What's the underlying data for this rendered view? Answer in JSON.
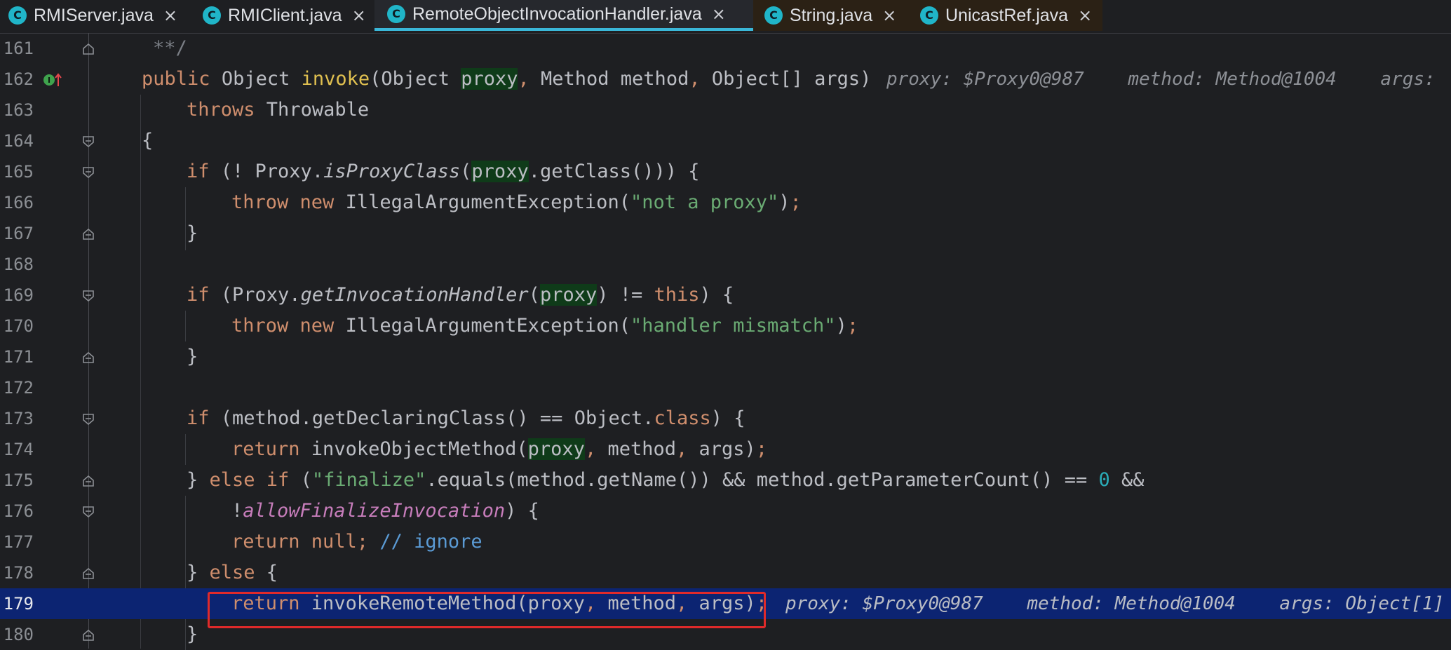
{
  "tabs": [
    {
      "label": "RMIServer.java",
      "active": false
    },
    {
      "label": "RMIClient.java",
      "active": false
    },
    {
      "label": "RemoteObjectInvocationHandler.java",
      "active": true
    },
    {
      "label": "String.java",
      "active": false
    },
    {
      "label": "UnicastRef.java",
      "active": false
    }
  ],
  "tab_icon_letter": "C",
  "close_glyph": "×",
  "lines": [
    {
      "num": "161"
    },
    {
      "num": "162"
    },
    {
      "num": "163"
    },
    {
      "num": "164"
    },
    {
      "num": "165"
    },
    {
      "num": "166"
    },
    {
      "num": "167"
    },
    {
      "num": "168"
    },
    {
      "num": "169"
    },
    {
      "num": "170"
    },
    {
      "num": "171"
    },
    {
      "num": "172"
    },
    {
      "num": "173"
    },
    {
      "num": "174"
    },
    {
      "num": "175"
    },
    {
      "num": "176"
    },
    {
      "num": "177"
    },
    {
      "num": "178"
    },
    {
      "num": "179"
    },
    {
      "num": "180"
    }
  ],
  "code": {
    "l161": "**/",
    "l162": {
      "public": "public",
      "type": "Object ",
      "name": "invoke",
      "open": "(Object ",
      "p1": "proxy",
      "c1": ",",
      "p2": " Method method",
      "c2": ",",
      "p3": " Object[] args)"
    },
    "l163": {
      "throws": "throws",
      "rest": " Throwable"
    },
    "l164": "{",
    "l165": {
      "if": "if",
      "a": " (! Proxy.",
      "m": "isProxyClass",
      "b": "(",
      "p": "proxy",
      "c": ".getClass())) {"
    },
    "l166": {
      "throw": "throw new",
      "a": " IllegalArgumentException(",
      "s": "\"not a proxy\"",
      "b": ")",
      "semi": ";"
    },
    "l167": "}",
    "l169": {
      "if": "if",
      "a": " (Proxy.",
      "m": "getInvocationHandler",
      "b": "(",
      "p": "proxy",
      "c": ") != ",
      "this": "this",
      "d": ") {"
    },
    "l170": {
      "throw": "throw new",
      "a": " IllegalArgumentException(",
      "s": "\"handler mismatch\"",
      "b": ")",
      "semi": ";"
    },
    "l171": "}",
    "l173": {
      "if": "if",
      "a": " (method.getDeclaringClass() == Object.",
      "cls": "class",
      "b": ") {"
    },
    "l174": {
      "ret": "return",
      "a": " invokeObjectMethod(",
      "p": "proxy",
      "c1": ",",
      "b": " method",
      "c2": ",",
      "d": " args)",
      "semi": ";"
    },
    "l175": {
      "a": "} ",
      "els": "else if",
      "b": " (",
      "s": "\"finalize\"",
      "c": ".equals(method.getName()) && method.getParameterCount() == ",
      "n": "0",
      "d": " &&"
    },
    "l176": {
      "a": "!",
      "f": "allowFinalizeInvocation",
      "b": ") {"
    },
    "l177": {
      "ret": "return null",
      "semi": ";",
      "cmt": " // ignore"
    },
    "l178": {
      "a": "} ",
      "els": "else",
      "b": " {"
    },
    "l179": {
      "ret": "return",
      "a": " invokeRemoteMethod(proxy",
      "c1": ",",
      "b": " method",
      "c2": ",",
      "d": " args)",
      "semi": ";"
    },
    "l180": "}"
  },
  "debug_hints": {
    "l162": "proxy: $Proxy0@987    method: Method@1004    args:",
    "l179": "proxy: $Proxy0@987    method: Method@1004    args: Object[1]"
  },
  "colors": {
    "keyword": "#cf8e6d",
    "method": "#56a8f5",
    "string": "#6aab73",
    "number": "#2aacb8",
    "field": "#c77dbb",
    "current_line": "#0c2472",
    "active_tab_underline": "#3ab7d8",
    "highlight_box": "#e02a2a"
  },
  "icons": {
    "tab": "java-class-icon",
    "gutter_162": "implementation-override-icon",
    "fold": "fold-icon"
  }
}
